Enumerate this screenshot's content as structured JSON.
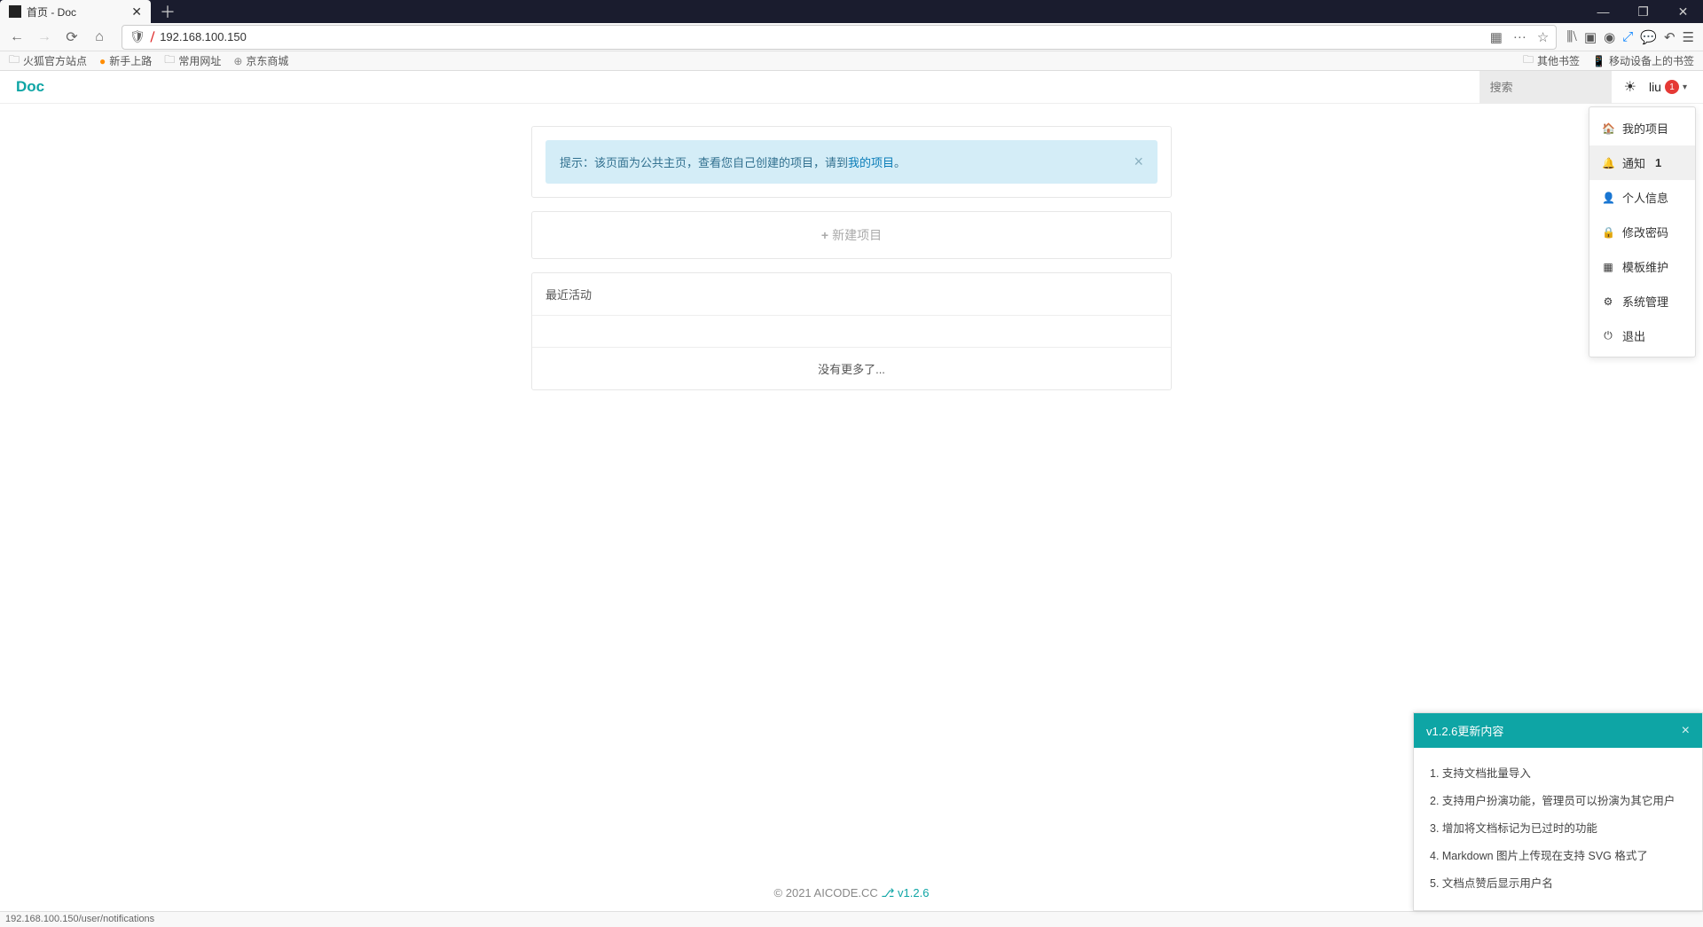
{
  "browser": {
    "tab_title": "首页 - Doc",
    "url": "192.168.100.150",
    "window": {
      "min": "—",
      "max": "❐",
      "close": "✕"
    },
    "bookmarks": {
      "left": [
        "火狐官方站点",
        "新手上路",
        "常用网址",
        "京东商城"
      ],
      "right": [
        "其他书签",
        "移动设备上的书签"
      ]
    }
  },
  "app": {
    "brand": "Doc",
    "search_placeholder": "搜索",
    "user": {
      "name": "liu",
      "badge": "1"
    }
  },
  "alert": {
    "prefix": "提示：该页面为公共主页，查看您自己创建的项目，请到 ",
    "link": "我的项目",
    "suffix": "。"
  },
  "new_project": "新建项目",
  "recent": {
    "title": "最近活动",
    "empty": "没有更多了..."
  },
  "dropdown": [
    {
      "icon": "🏠",
      "label": "我的项目"
    },
    {
      "icon": "🔔",
      "label": "通知",
      "badge": "1",
      "hover": true
    },
    {
      "icon": "👤",
      "label": "个人信息"
    },
    {
      "icon": "🔒",
      "label": "修改密码"
    },
    {
      "icon": "▦",
      "label": "模板维护"
    },
    {
      "icon": "⚙",
      "label": "系统管理"
    },
    {
      "icon": "⏻",
      "label": "退出"
    }
  ],
  "footer": {
    "copyright": "© 2021 AICODE.CC ",
    "github_icon": "⎇",
    "version": "v1.2.6"
  },
  "changelog": {
    "title": "v1.2.6更新内容",
    "items": [
      "1. 支持文档批量导入",
      "2. 支持用户扮演功能，管理员可以扮演为其它用户",
      "3. 增加将文档标记为已过时的功能",
      "4. Markdown 图片上传现在支持 SVG 格式了",
      "5. 文档点赞后显示用户名"
    ]
  },
  "statusbar": "192.168.100.150/user/notifications"
}
